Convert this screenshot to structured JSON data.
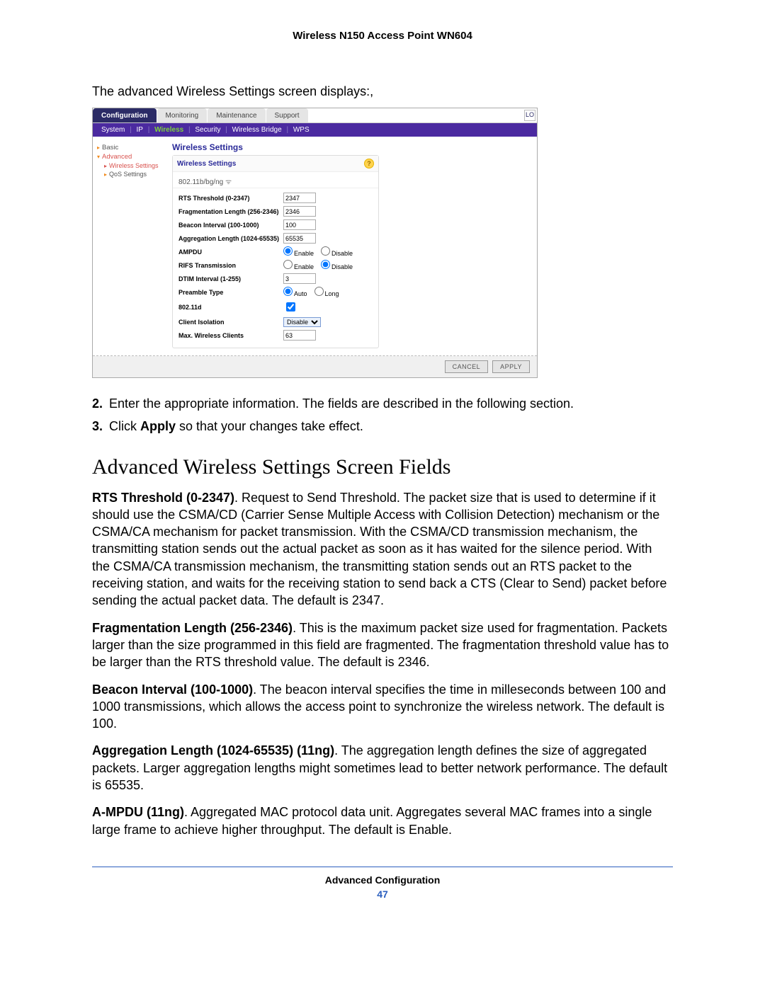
{
  "header": {
    "title": "Wireless N150 Access Point WN604"
  },
  "intro": "The advanced Wireless Settings screen displays:,",
  "screenshot": {
    "tabs": [
      "Configuration",
      "Monitoring",
      "Maintenance",
      "Support"
    ],
    "active_tab": 0,
    "subnav": [
      "System",
      "IP",
      "Wireless",
      "Security",
      "Wireless Bridge",
      "WPS"
    ],
    "subnav_active": 2,
    "sidebar": {
      "basic": "Basic",
      "advanced": "Advanced",
      "wireless_settings": "Wireless Settings",
      "qos_settings": "QoS Settings"
    },
    "panel_title_main": "Wireless Settings",
    "panel_title": "Wireless Settings",
    "mode": "802.11b/bg/ng",
    "rows": {
      "rts_label": "RTS Threshold (0-2347)",
      "rts_value": "2347",
      "frag_label": "Fragmentation Length (256-2346)",
      "frag_value": "2346",
      "beacon_label": "Beacon Interval (100-1000)",
      "beacon_value": "100",
      "agg_label": "Aggregation Length (1024-65535)",
      "agg_value": "65535",
      "ampdu_label": "AMPDU",
      "enable": "Enable",
      "disable": "Disable",
      "rifs_label": "RIFS Transmission",
      "dtim_label": "DTIM Interval (1-255)",
      "dtim_value": "3",
      "preamble_label": "Preamble Type",
      "auto": "Auto",
      "long": "Long",
      "d802_label": "802.11d",
      "client_iso_label": "Client Isolation",
      "client_iso_value": "Disable",
      "max_clients_label": "Max. Wireless Clients",
      "max_clients_value": "63"
    },
    "buttons": {
      "cancel": "CANCEL",
      "apply": "APPLY"
    }
  },
  "steps": [
    {
      "n": "2.",
      "text_before": "Enter the appropriate information. The fields are described in the following section.",
      "bold": ""
    },
    {
      "n": "3.",
      "text_before": "Click ",
      "bold": "Apply",
      "text_after": " so that your changes take effect."
    }
  ],
  "subheading": "Advanced Wireless Settings Screen Fields",
  "paras": [
    {
      "bold": "RTS Threshold (0-2347)",
      "text": ". Request to Send Threshold. The packet size that is used to determine if it should use the CSMA/CD (Carrier Sense Multiple Access with Collision Detection) mechanism or the CSMA/CA mechanism for packet transmission. With the CSMA/CD transmission mechanism, the transmitting station sends out the actual packet as soon as it has waited for the silence period. With the CSMA/CA transmission mechanism, the transmitting station sends out an RTS packet to the receiving station, and waits for the receiving station to send back a CTS (Clear to Send) packet before sending the actual packet data. The default is 2347."
    },
    {
      "bold": "Fragmentation Length (256-2346)",
      "text": ". This is the maximum packet size used for fragmentation. Packets larger than the size programmed in this field are fragmented. The fragmentation threshold value has to be larger than the RTS threshold value. The default is 2346."
    },
    {
      "bold": "Beacon Interval (100-1000)",
      "text": ". The beacon interval specifies the time in milleseconds between 100 and 1000 transmissions, which allows the access point to synchronize the wireless network. The default is 100."
    },
    {
      "bold": "Aggregation Length (1024-65535) (11ng)",
      "text": ". The aggregation length defines the size of aggregated packets. Larger aggregation lengths might sometimes lead to better network performance. The default is 65535."
    },
    {
      "bold": "A-MPDU (11ng)",
      "text": ". Aggregated MAC protocol data unit. Aggregates several MAC frames into a single large frame to achieve higher throughput. The default is Enable."
    }
  ],
  "footer": {
    "section": "Advanced Configuration",
    "page": "47"
  }
}
